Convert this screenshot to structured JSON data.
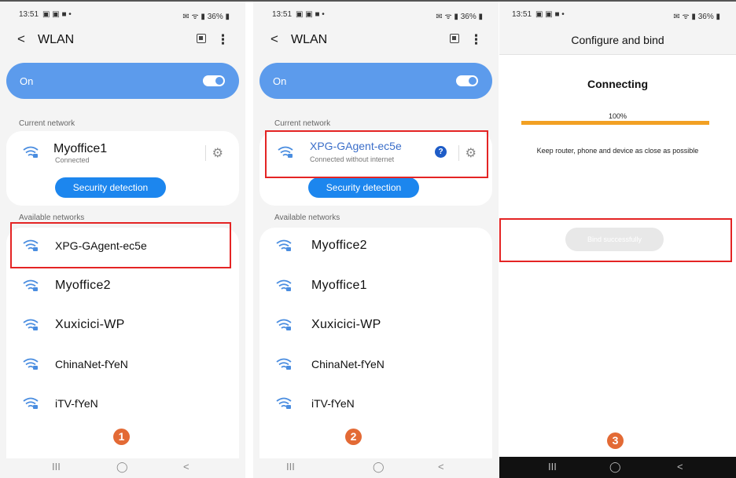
{
  "status": {
    "time": "13:51",
    "left_icons": "▣ ▣ ■ •",
    "right_icons": "✉ ᯤ ▮ 36% ▮"
  },
  "wlan": {
    "title": "WLAN",
    "back_glyph": "<",
    "more_glyph": "⋮",
    "on_label": "On",
    "current_label": "Current network",
    "available_label": "Available networks",
    "security_button": "Security detection"
  },
  "panel1": {
    "current": {
      "name": "Myoffice1",
      "status": "Connected"
    },
    "networks": [
      {
        "name": "XPG-GAgent-ec5e"
      },
      {
        "name": "Myoffice2"
      },
      {
        "name": "Xuxicici-WP"
      },
      {
        "name": "ChinaNet-fYeN"
      },
      {
        "name": "iTV-fYeN"
      }
    ],
    "step": "1"
  },
  "panel2": {
    "current": {
      "name": "XPG-GAgent-ec5e",
      "status": "Connected without internet"
    },
    "networks": [
      {
        "name": "Myoffice2"
      },
      {
        "name": "Myoffice1"
      },
      {
        "name": "Xuxicici-WP"
      },
      {
        "name": "ChinaNet-fYeN"
      },
      {
        "name": "iTV-fYeN"
      }
    ],
    "step": "2"
  },
  "panel3": {
    "title": "Configure and bind",
    "connecting": "Connecting",
    "progress_text": "100%",
    "progress": 1.0,
    "hint": "Keep router, phone and device as close as possible",
    "bind_button": "Bind successfully",
    "step": "3"
  },
  "nav": {
    "recents": "III",
    "home": "◯",
    "back": "<"
  },
  "colors": {
    "accent_blue": "#1c86ee",
    "on_bar": "#5c9bec",
    "progress": "#f2a023",
    "highlight": "#e42424",
    "step_badge": "#e36a35"
  }
}
